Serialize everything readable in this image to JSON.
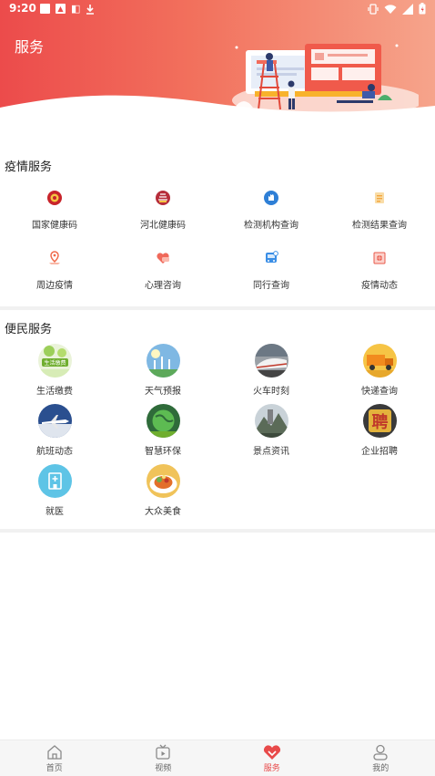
{
  "status_bar": {
    "time": "9:20"
  },
  "header": {
    "title": "服务"
  },
  "epidemic": {
    "title": "疫情服务",
    "items": [
      {
        "label": "国家健康码",
        "icon": "national-emblem-icon",
        "color": "#c8242b"
      },
      {
        "label": "河北健康码",
        "icon": "hebei-emblem-icon",
        "color": "#b62d3b"
      },
      {
        "label": "检测机构查询",
        "icon": "hand-icon",
        "color": "#2e7fd6"
      },
      {
        "label": "检测结果查询",
        "icon": "document-icon",
        "color": "#f3a63c"
      },
      {
        "label": "周边疫情",
        "icon": "location-map-icon",
        "color": "#f06a4a"
      },
      {
        "label": "心理咨询",
        "icon": "heart-chat-icon",
        "color": "#f0695a"
      },
      {
        "label": "同行查询",
        "icon": "bus-icon",
        "color": "#3a8ee6"
      },
      {
        "label": "疫情动态",
        "icon": "news-icon",
        "color": "#e9594b"
      }
    ]
  },
  "convenience": {
    "title": "便民服务",
    "items": [
      {
        "label": "生活缴费",
        "icon": "life-payment-photo"
      },
      {
        "label": "天气预报",
        "icon": "weather-photo"
      },
      {
        "label": "火车时刻",
        "icon": "train-photo"
      },
      {
        "label": "快递查询",
        "icon": "express-truck-photo"
      },
      {
        "label": "航班动态",
        "icon": "airplane-photo"
      },
      {
        "label": "智慧环保",
        "icon": "earth-photo"
      },
      {
        "label": "景点资讯",
        "icon": "scenic-photo"
      },
      {
        "label": "企业招聘",
        "icon": "recruit-photo"
      },
      {
        "label": "就医",
        "icon": "hospital-icon",
        "color": "#5ec4e6"
      },
      {
        "label": "大众美食",
        "icon": "food-photo"
      }
    ]
  },
  "bottom_nav": [
    {
      "label": "首页",
      "icon": "home-icon"
    },
    {
      "label": "视频",
      "icon": "video-icon"
    },
    {
      "label": "服务",
      "icon": "service-heart-icon",
      "active": true
    },
    {
      "label": "我的",
      "icon": "user-icon"
    }
  ],
  "colors": {
    "accent": "#e84a4a",
    "header_start": "#ec4b4b",
    "header_end": "#f6a48b"
  }
}
